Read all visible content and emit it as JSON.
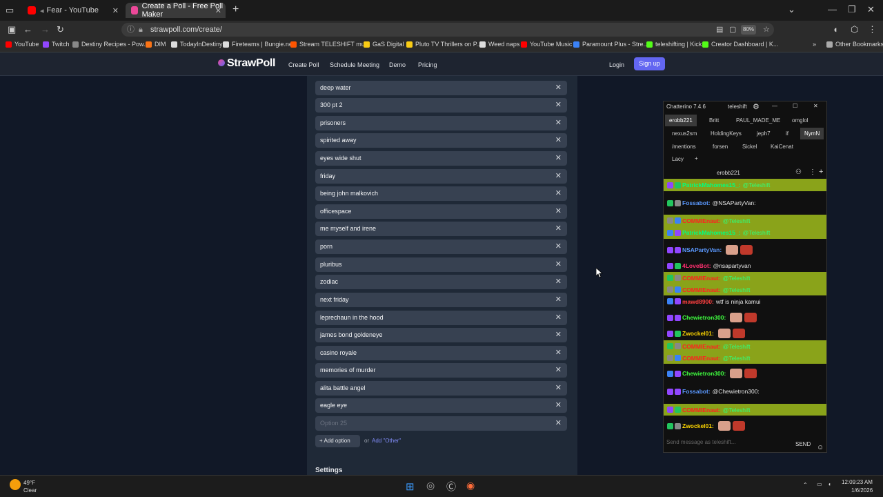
{
  "tabs": [
    {
      "title": "Fear - YouTube",
      "color": "#ff0000"
    },
    {
      "title": "Create a Poll - Free Poll Maker",
      "color": "#ec4899"
    }
  ],
  "url": "strawpoll.com/create/",
  "zoom": "80%",
  "bookmarks": [
    {
      "label": "YouTube",
      "color": "#ff0000"
    },
    {
      "label": "Twitch",
      "color": "#9146ff"
    },
    {
      "label": "Destiny Recipes - Pow...",
      "color": "#888888"
    },
    {
      "label": "DIM",
      "color": "#f97316"
    },
    {
      "label": "TodayInDestiny",
      "color": "#dddddd"
    },
    {
      "label": "Fireteams | Bungie.net",
      "color": "#dddddd"
    },
    {
      "label": "Stream TELESHIFT mu...",
      "color": "#ff5500"
    },
    {
      "label": "GaS Digital",
      "color": "#facc15"
    },
    {
      "label": "Pluto TV Thrillers on P...",
      "color": "#facc15"
    },
    {
      "label": "Weed naps",
      "color": "#dddddd"
    },
    {
      "label": "YouTube Music",
      "color": "#ff0000"
    },
    {
      "label": "Paramount Plus - Stre...",
      "color": "#3b82f6"
    },
    {
      "label": "teleshifting | Kick",
      "color": "#53fc18"
    },
    {
      "label": "Creator Dashboard | K...",
      "color": "#53fc18"
    }
  ],
  "other_bookmarks": "Other Bookmarks",
  "site": {
    "brand": "StrawPoll",
    "nav": [
      "Create Poll",
      "Schedule Meeting",
      "Demo",
      "Pricing"
    ],
    "login": "Login",
    "signup": "Sign up"
  },
  "options": [
    "deep water",
    "300 pt 2",
    "prisoners",
    "spirited away",
    "eyes wide shut",
    "friday",
    "being john malkovich",
    "officespace",
    "me myself and irene",
    "porn",
    "pluribus",
    "zodiac",
    "next friday",
    "leprechaun in the hood",
    "james bond goldeneye",
    "casino royale",
    "memories of murder",
    "alita battle angel",
    "eagle eye"
  ],
  "option_placeholder": "Option 25",
  "add_option": "Add option",
  "or_text": "or",
  "add_other": "Add \"Other\"",
  "settings_label": "Settings",
  "chatterino": {
    "title": "Chatterino 7.4.6",
    "user": "teleshift",
    "tabs_row1": [
      "erobb221",
      "Britt",
      "PAUL_MADE_ME",
      "omglol"
    ],
    "tabs_row2": [
      "nexus2sm",
      "HoldingKeys",
      "jeph7",
      "if",
      "NymN"
    ],
    "tabs_row3": [
      "/mentions",
      "forsen",
      "Sickel",
      "KaiCenat"
    ],
    "tabs_row4": [
      "Lacy"
    ],
    "channel": "erobb221",
    "messages": [
      {
        "user": "PatrickMahomes15_:",
        "text": "@Teleshift",
        "ucolor": "#00ff7f",
        "hl": true
      },
      {
        "user": "Fossabot:",
        "text": "@NSAPartyVan:",
        "ucolor": "#5b99ff",
        "hl": false
      },
      {
        "user": "COMMIEnaut:",
        "text": "@Teleshift",
        "ucolor": "#ff2020",
        "hl": true
      },
      {
        "user": "PatrickMahomes15_:",
        "text": "@Teleshift",
        "ucolor": "#00ff7f",
        "hl": true
      },
      {
        "user": "NSAPartyVan:",
        "text": "",
        "ucolor": "#5b99ff",
        "hl": false
      },
      {
        "user": "4LoveBot:",
        "text": "@nsapartyvan",
        "ucolor": "#ff3070",
        "hl": false
      },
      {
        "user": "COMMIEnaut:",
        "text": "@Teleshift",
        "ucolor": "#ff2020",
        "hl": true
      },
      {
        "user": "COMMIEnaut:",
        "text": "@Teleshift",
        "ucolor": "#ff2020",
        "hl": true
      },
      {
        "user": "mawd8900:",
        "text": "wtf is ninja kamui",
        "ucolor": "#ff4040",
        "hl": false
      },
      {
        "user": "Chewietron300:",
        "text": "",
        "ucolor": "#40ff40",
        "hl": false
      },
      {
        "user": "Zwockel01:",
        "text": "",
        "ucolor": "#ffd700",
        "hl": false
      },
      {
        "user": "COMMIEnaut:",
        "text": "@Teleshift",
        "ucolor": "#ff2020",
        "hl": true
      },
      {
        "user": "COMMIEnaut:",
        "text": "@Teleshift",
        "ucolor": "#ff2020",
        "hl": true
      },
      {
        "user": "Chewietron300:",
        "text": "",
        "ucolor": "#40ff40",
        "hl": false
      },
      {
        "user": "Fossabot:",
        "text": "@Chewietron300:",
        "ucolor": "#5b99ff",
        "hl": false
      },
      {
        "user": "COMMIEnaut:",
        "text": "@Teleshift",
        "ucolor": "#ff2020",
        "hl": true
      },
      {
        "user": "Zwockel01:",
        "text": "",
        "ucolor": "#ffd700",
        "hl": false
      }
    ],
    "input_placeholder": "Send message as teleshift...",
    "send": "SEND"
  },
  "taskbar": {
    "weather_temp": "49°F",
    "weather_text": "Clear",
    "time": "12:09:23 AM",
    "date": "1/6/2026"
  }
}
